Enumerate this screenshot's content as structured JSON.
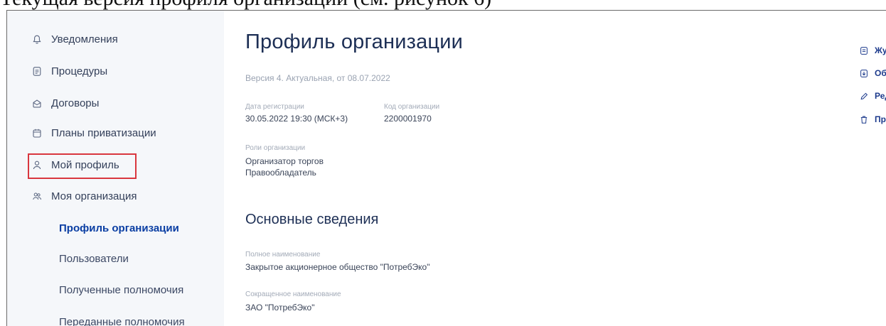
{
  "caption": "Текущая версия профиля организации (см. рисунок 6)",
  "sidebar": {
    "items": [
      {
        "label": "Уведомления",
        "icon": "bell-icon"
      },
      {
        "label": "Процедуры",
        "icon": "document-icon"
      },
      {
        "label": "Договоры",
        "icon": "contract-icon"
      },
      {
        "label": "Планы приватизации",
        "icon": "calendar-icon"
      },
      {
        "label": "Мой профиль",
        "icon": "user-icon"
      },
      {
        "label": "Моя организация",
        "icon": "users-icon"
      }
    ],
    "sub_items": [
      {
        "label": "Профиль организации"
      },
      {
        "label": "Пользователи"
      },
      {
        "label": "Полученные полномочия"
      },
      {
        "label": "Переданные полномочия"
      }
    ]
  },
  "main": {
    "title": "Профиль организации",
    "version": "Версия 4. Актуальная, от 08.07.2022",
    "reg_date_label": "Дата регистрации",
    "reg_date_value": "30.05.2022 19:30 (МСК+3)",
    "org_code_label": "Код организации",
    "org_code_value": "2200001970",
    "roles_label": "Роли организации",
    "roles": [
      "Организатор торгов",
      "Правообладатель"
    ],
    "section_title": "Основные сведения",
    "full_name_label": "Полное наименование",
    "full_name_value": "Закрытое акционерное общество \"ПотребЭко\"",
    "short_name_label": "Сокращенное наименование",
    "short_name_value": "ЗАО \"ПотребЭко\""
  },
  "actions": [
    {
      "label": "Журнал событий",
      "icon": "journal-icon"
    },
    {
      "label": "Обновить сведения из ЕСИА",
      "icon": "refresh-icon"
    },
    {
      "label": "Редактировать",
      "icon": "pencil-icon"
    },
    {
      "label": "Прекратить регистрацию",
      "icon": "trash-icon"
    }
  ],
  "colors": {
    "accent": "#0a3ea3",
    "highlight": "#d9363e",
    "sidebar_bg": "#f5f7fa"
  }
}
